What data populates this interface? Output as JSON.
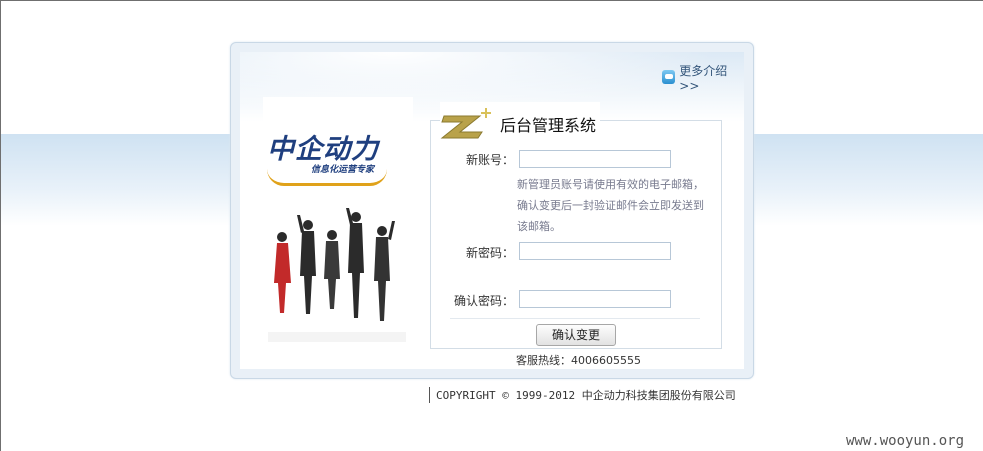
{
  "header": {
    "more_link": "更多介绍>>"
  },
  "logo": {
    "brand": "中企动力",
    "slogan": "信息化运营专家"
  },
  "form": {
    "title": "后台管理系统",
    "account_label": "新账号：",
    "account_value": "",
    "hint": "新管理员账号请使用有效的电子邮箱，确认变更后一封验证邮件会立即发送到该邮箱。",
    "password_label": "新密码：",
    "confirm_label": "确认密码：",
    "submit_label": "确认变更",
    "hotline": "客服热线：4006605555"
  },
  "footer": {
    "copyright": "COPYRIGHT © 1999-2012 中企动力科技集团股份有限公司"
  },
  "watermark": "www.wooyun.org",
  "colors": {
    "accent": "#1f3f7f",
    "gold": "#e0a21a",
    "band": "#cfe2f2"
  }
}
